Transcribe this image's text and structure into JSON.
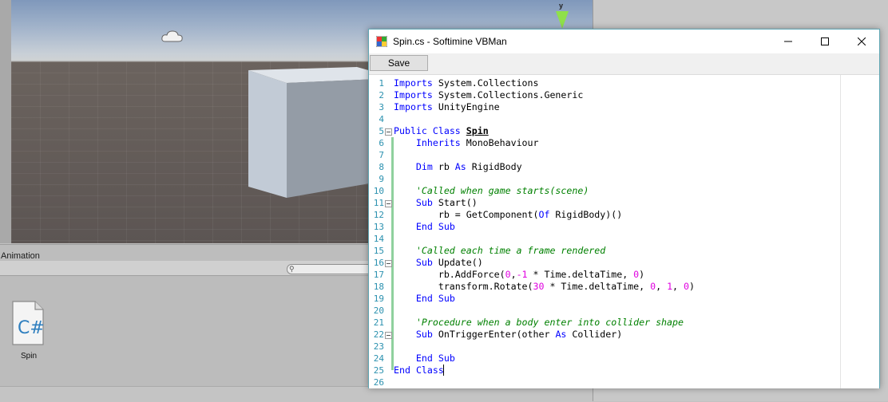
{
  "unity": {
    "animation_tab": "Animation",
    "gizmo_axis": "y",
    "asset": {
      "name": "Spin",
      "icon": "csharp-file-icon"
    }
  },
  "editor": {
    "title": "Spin.cs - Softimine VBMan",
    "app_icon": "vbman-app-icon",
    "controls": {
      "minimize": "minimize-icon",
      "maximize": "maximize-icon",
      "close": "close-icon"
    },
    "toolbar": {
      "save_label": "Save"
    },
    "colors": {
      "keyword": "#0000ff",
      "comment": "#008000",
      "number": "#e000e0",
      "line_number": "#2b91af",
      "border": "#5fa6b4"
    },
    "code_lines": [
      "Imports System.Collections",
      "Imports System.Collections.Generic",
      "Imports UnityEngine",
      "",
      "Public Class Spin",
      "    Inherits MonoBehaviour",
      "",
      "    Dim rb As RigidBody",
      "",
      "    'Called when game starts(scene)",
      "    Sub Start()",
      "        rb = GetComponent(Of RigidBody)()",
      "    End Sub",
      "",
      "    'Called each time a frame rendered",
      "    Sub Update()",
      "        rb.AddForce(0,-1 * Time.deltaTime, 0)",
      "        transform.Rotate(30 * Time.deltaTime, 0, 1, 0)",
      "    End Sub",
      "",
      "    'Procedure when a body enter into collider shape",
      "    Sub OnTriggerEnter(other As Collider)",
      "",
      "    End Sub",
      "End Class",
      ""
    ]
  }
}
